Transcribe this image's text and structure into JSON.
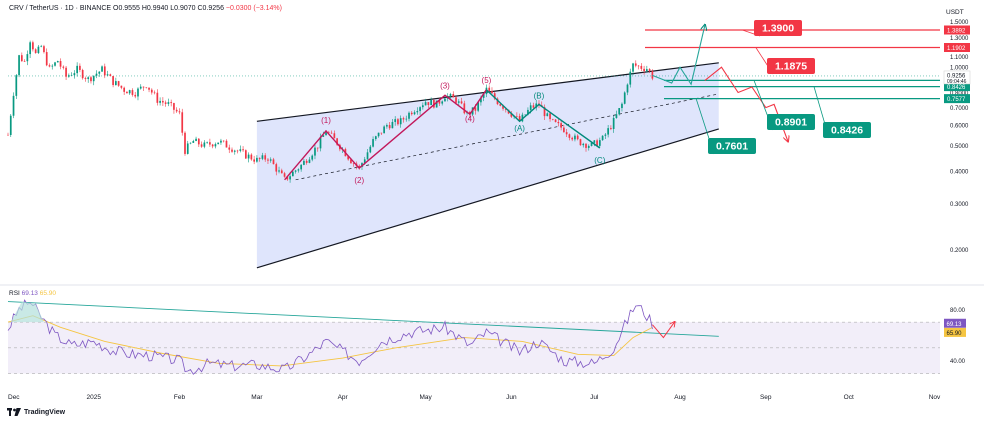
{
  "header": {
    "symbol": "CRV / TetherUS · 1D · BINANCE",
    "open": "O0.9555",
    "high": "H0.9940",
    "low": "L0.9070",
    "close": "C0.9256",
    "change": "−0.0300 (−3.14%)"
  },
  "unit_label": "USDT",
  "brand": "TradingView",
  "colors": {
    "bull": "#089981",
    "bear": "#f23645",
    "wave_red": "#c2185b",
    "wave_teal": "#00897b",
    "channel_fill": "#d9e1fb",
    "rsi_line": "#7e57c2",
    "rsi_ma": "#f5c542"
  },
  "chart_data": {
    "type": "candlestick",
    "title": "",
    "scale": "log",
    "ylim": [
      0.15,
      1.6
    ],
    "y_ticks": [
      "1.5000",
      "1.3000",
      "1.1000",
      "1.0000",
      "0.9000",
      "0.8000",
      "0.7000",
      "0.6000",
      "0.5000",
      "0.4000",
      "0.3000",
      "0.2000"
    ],
    "y_tick_values": [
      1.5,
      1.3,
      1.1,
      1.0,
      0.9,
      0.8,
      0.7,
      0.6,
      0.5,
      0.4,
      0.3,
      0.2
    ],
    "x_start": "2024-12-01",
    "x_ticks": [
      {
        "label": "Dec",
        "date": "2024-12-01"
      },
      {
        "label": "2025",
        "date": "2025-01-01"
      },
      {
        "label": "Feb",
        "date": "2025-02-01"
      },
      {
        "label": "Mar",
        "date": "2025-03-01"
      },
      {
        "label": "Apr",
        "date": "2025-04-01"
      },
      {
        "label": "May",
        "date": "2025-05-01"
      },
      {
        "label": "Jun",
        "date": "2025-06-01"
      },
      {
        "label": "Jul",
        "date": "2025-07-01"
      },
      {
        "label": "Aug",
        "date": "2025-08-01"
      },
      {
        "label": "Sep",
        "date": "2025-09-01"
      },
      {
        "label": "Oct",
        "date": "2025-10-01"
      },
      {
        "label": "Nov",
        "date": "2025-11-01"
      }
    ],
    "price_path": [
      [
        "2024-12-01",
        0.55
      ],
      [
        "2024-12-03",
        0.8
      ],
      [
        "2024-12-05",
        1.1
      ],
      [
        "2024-12-07",
        1.05
      ],
      [
        "2024-12-09",
        1.28
      ],
      [
        "2024-12-11",
        1.12
      ],
      [
        "2024-12-13",
        1.2
      ],
      [
        "2024-12-16",
        0.98
      ],
      [
        "2024-12-19",
        1.06
      ],
      [
        "2024-12-22",
        0.92
      ],
      [
        "2024-12-26",
        0.98
      ],
      [
        "2024-12-30",
        0.9
      ],
      [
        "2025-01-04",
        0.98
      ],
      [
        "2025-01-08",
        0.88
      ],
      [
        "2025-01-12",
        0.82
      ],
      [
        "2025-01-16",
        0.8
      ],
      [
        "2025-01-20",
        0.86
      ],
      [
        "2025-01-24",
        0.75
      ],
      [
        "2025-01-28",
        0.72
      ],
      [
        "2025-02-01",
        0.66
      ],
      [
        "2025-02-03",
        0.48
      ],
      [
        "2025-02-06",
        0.52
      ],
      [
        "2025-02-10",
        0.5
      ],
      [
        "2025-02-15",
        0.52
      ],
      [
        "2025-02-20",
        0.49
      ],
      [
        "2025-02-25",
        0.46
      ],
      [
        "2025-03-01",
        0.44
      ],
      [
        "2025-03-05",
        0.45
      ],
      [
        "2025-03-11",
        0.37
      ],
      [
        "2025-03-17",
        0.42
      ],
      [
        "2025-03-23",
        0.5
      ],
      [
        "2025-03-26",
        0.57
      ],
      [
        "2025-03-31",
        0.5
      ],
      [
        "2025-04-04",
        0.44
      ],
      [
        "2025-04-07",
        0.41
      ],
      [
        "2025-04-12",
        0.52
      ],
      [
        "2025-04-17",
        0.6
      ],
      [
        "2025-04-22",
        0.62
      ],
      [
        "2025-04-26",
        0.68
      ],
      [
        "2025-05-01",
        0.74
      ],
      [
        "2025-05-05",
        0.72
      ],
      [
        "2025-05-08",
        0.78
      ],
      [
        "2025-05-12",
        0.75
      ],
      [
        "2025-05-16",
        0.66
      ],
      [
        "2025-05-19",
        0.69
      ],
      [
        "2025-05-23",
        0.82
      ],
      [
        "2025-05-27",
        0.74
      ],
      [
        "2025-05-31",
        0.68
      ],
      [
        "2025-06-04",
        0.62
      ],
      [
        "2025-06-08",
        0.7
      ],
      [
        "2025-06-11",
        0.72
      ],
      [
        "2025-06-15",
        0.62
      ],
      [
        "2025-06-20",
        0.58
      ],
      [
        "2025-06-25",
        0.52
      ],
      [
        "2025-06-30",
        0.5
      ],
      [
        "2025-07-04",
        0.53
      ],
      [
        "2025-07-08",
        0.62
      ],
      [
        "2025-07-11",
        0.72
      ],
      [
        "2025-07-13",
        0.88
      ],
      [
        "2025-07-15",
        1.02
      ],
      [
        "2025-07-18",
        1.0
      ],
      [
        "2025-07-20",
        0.99
      ],
      [
        "2025-07-22",
        0.9256
      ]
    ],
    "current_price": "0.9256",
    "countdown": "09:04:46",
    "levels": [
      {
        "price": 1.3892,
        "label": "1.3892",
        "color": "#f23645"
      },
      {
        "price": 1.1902,
        "label": "1.1902",
        "color": "#f23645"
      },
      {
        "price": 0.8901,
        "label": "0.8901",
        "color": "#089981"
      },
      {
        "price": 0.8426,
        "label": "0.8426",
        "color": "#089981"
      },
      {
        "price": 0.7577,
        "label": "0.7577",
        "color": "#089981"
      }
    ],
    "callouts": [
      {
        "text": "1.3900",
        "price": 1.39,
        "color": "#f23645"
      },
      {
        "text": "1.1875",
        "price": 1.1875,
        "color": "#f23645"
      },
      {
        "text": "0.8901",
        "price": 0.8901,
        "color": "#089981"
      },
      {
        "text": "0.8426",
        "price": 0.8426,
        "color": "#089981"
      },
      {
        "text": "0.7601",
        "price": 0.7601,
        "color": "#089981"
      }
    ],
    "channel": {
      "upper": [
        [
          "2025-03-01",
          0.62
        ],
        [
          "2025-08-15",
          1.04
        ]
      ],
      "lower": [
        [
          "2025-03-01",
          0.17
        ],
        [
          "2025-08-15",
          0.58
        ]
      ],
      "mid": [
        [
          "2025-03-15",
          0.37
        ],
        [
          "2025-08-15",
          0.79
        ]
      ]
    },
    "wave_labels": [
      {
        "text": "(1)",
        "date": "2025-03-26",
        "price": 0.61,
        "color": "#c2185b"
      },
      {
        "text": "(2)",
        "date": "2025-04-07",
        "price": 0.36,
        "color": "#c2185b"
      },
      {
        "text": "(3)",
        "date": "2025-05-08",
        "price": 0.83,
        "color": "#c2185b"
      },
      {
        "text": "(4)",
        "date": "2025-05-17",
        "price": 0.62,
        "color": "#c2185b"
      },
      {
        "text": "(5)",
        "date": "2025-05-23",
        "price": 0.87,
        "color": "#c2185b"
      },
      {
        "text": "(A)",
        "date": "2025-06-04",
        "price": 0.57,
        "color": "#00897b"
      },
      {
        "text": "(B)",
        "date": "2025-06-11",
        "price": 0.76,
        "color": "#00897b"
      },
      {
        "text": "(C)",
        "date": "2025-07-03",
        "price": 0.43,
        "color": "#00897b"
      }
    ],
    "wave_red_path": [
      [
        "2025-03-11",
        0.37
      ],
      [
        "2025-03-26",
        0.57
      ],
      [
        "2025-04-07",
        0.41
      ],
      [
        "2025-05-08",
        0.78
      ],
      [
        "2025-05-17",
        0.66
      ],
      [
        "2025-05-23",
        0.82
      ]
    ],
    "wave_teal_path": [
      [
        "2025-05-23",
        0.82
      ],
      [
        "2025-06-04",
        0.62
      ],
      [
        "2025-06-11",
        0.72
      ],
      [
        "2025-07-03",
        0.49
      ]
    ],
    "proj_teal": [
      [
        "2025-07-22",
        0.93
      ],
      [
        "2025-07-29",
        0.87
      ],
      [
        "2025-08-01",
        1.0
      ],
      [
        "2025-08-05",
        0.86
      ],
      [
        "2025-08-10",
        1.45
      ]
    ],
    "proj_red": [
      [
        "2025-08-10",
        0.89
      ],
      [
        "2025-08-16",
        1.0
      ],
      [
        "2025-08-22",
        0.8
      ],
      [
        "2025-08-27",
        0.84
      ],
      [
        "2025-09-01",
        0.7
      ],
      [
        "2025-09-04",
        0.72
      ],
      [
        "2025-09-09",
        0.52
      ]
    ],
    "rsi": {
      "label": "RSI",
      "value": "69.13",
      "ma_value": "65.90",
      "ylim": [
        25,
        95
      ],
      "ticks": [
        "80.00",
        "40.00"
      ],
      "tick_values": [
        80,
        40
      ],
      "bands": [
        70,
        50,
        30
      ],
      "path": [
        [
          "2024-12-01",
          65
        ],
        [
          "2024-12-05",
          80
        ],
        [
          "2024-12-09",
          86
        ],
        [
          "2024-12-13",
          74
        ],
        [
          "2024-12-18",
          60
        ],
        [
          "2024-12-24",
          52
        ],
        [
          "2025-01-01",
          55
        ],
        [
          "2025-01-08",
          48
        ],
        [
          "2025-01-15",
          45
        ],
        [
          "2025-01-22",
          44
        ],
        [
          "2025-02-01",
          40
        ],
        [
          "2025-02-04",
          32
        ],
        [
          "2025-02-12",
          38
        ],
        [
          "2025-02-20",
          36
        ],
        [
          "2025-03-01",
          37
        ],
        [
          "2025-03-11",
          33
        ],
        [
          "2025-03-20",
          45
        ],
        [
          "2025-03-26",
          55
        ],
        [
          "2025-04-07",
          40
        ],
        [
          "2025-04-15",
          55
        ],
        [
          "2025-04-25",
          62
        ],
        [
          "2025-05-08",
          66
        ],
        [
          "2025-05-17",
          52
        ],
        [
          "2025-05-23",
          62
        ],
        [
          "2025-06-04",
          47
        ],
        [
          "2025-06-11",
          55
        ],
        [
          "2025-06-20",
          40
        ],
        [
          "2025-07-01",
          38
        ],
        [
          "2025-07-08",
          50
        ],
        [
          "2025-07-13",
          72
        ],
        [
          "2025-07-16",
          84
        ],
        [
          "2025-07-19",
          78
        ],
        [
          "2025-07-22",
          69
        ]
      ],
      "ma_path": [
        [
          "2024-12-01",
          70
        ],
        [
          "2024-12-10",
          75
        ],
        [
          "2024-12-20",
          66
        ],
        [
          "2025-01-05",
          55
        ],
        [
          "2025-01-25",
          46
        ],
        [
          "2025-02-15",
          38
        ],
        [
          "2025-03-10",
          36
        ],
        [
          "2025-04-01",
          42
        ],
        [
          "2025-04-20",
          50
        ],
        [
          "2025-05-15",
          58
        ],
        [
          "2025-06-05",
          55
        ],
        [
          "2025-06-25",
          45
        ],
        [
          "2025-07-08",
          44
        ],
        [
          "2025-07-15",
          58
        ],
        [
          "2025-07-22",
          65.9
        ]
      ],
      "trendline": [
        [
          "2024-12-01",
          86
        ],
        [
          "2025-08-15",
          59
        ]
      ],
      "proj": [
        [
          "2025-07-22",
          68
        ],
        [
          "2025-07-26",
          58
        ],
        [
          "2025-07-30",
          70
        ]
      ]
    }
  }
}
